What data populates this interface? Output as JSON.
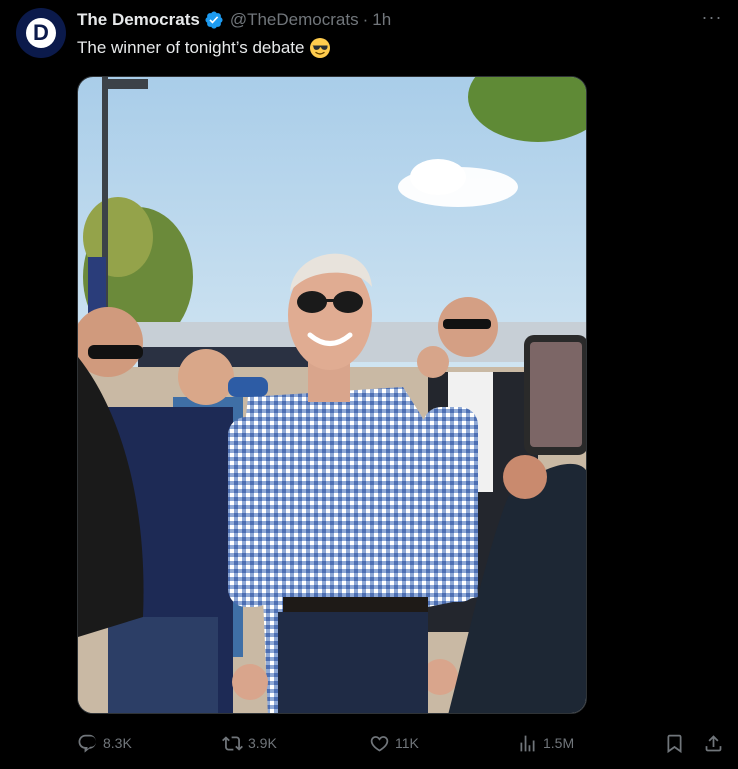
{
  "author": {
    "avatar_letter": "D",
    "display_name": "The Democrats",
    "handle": "@TheDemocrats",
    "separator": "·",
    "timestamp": "1h",
    "avatar_color": "#0b1a4b",
    "verified_color": "#1d9bf0"
  },
  "tweet": {
    "text": "The winner of tonight’s debate",
    "emoji": "smiling-face-with-sunglasses-emoji",
    "more_label": "···"
  },
  "media": {
    "subject": "man-in-aviator-sunglasses-and-checked-shirt-photo"
  },
  "actions": {
    "replies": "8.3K",
    "reposts": "3.9K",
    "likes": "11K",
    "views": "1.5M",
    "icons": [
      "reply-icon",
      "repost-icon",
      "like-icon",
      "views-icon",
      "bookmark-icon",
      "share-icon"
    ]
  },
  "colors": {
    "background": "#000000",
    "text_primary": "#e7e9ea",
    "text_secondary": "#71767b",
    "border": "#2f3336"
  }
}
